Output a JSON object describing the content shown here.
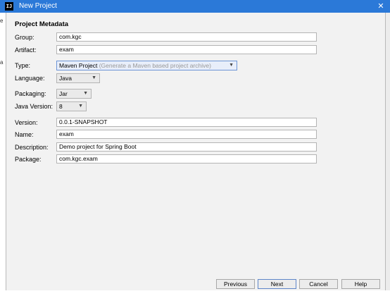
{
  "window": {
    "title": "New Project",
    "icon_text": "IJ"
  },
  "section_title": "Project Metadata",
  "fields": {
    "group": {
      "label": "Group:",
      "value": "com.kgc"
    },
    "artifact": {
      "label": "Artifact:",
      "value": "exam"
    },
    "type": {
      "label": "Type:",
      "value": "Maven Project",
      "hint": "(Generate a Maven based project archive)"
    },
    "language": {
      "label": "Language:",
      "value": "Java"
    },
    "packaging": {
      "label": "Packaging:",
      "value": "Jar"
    },
    "java_version": {
      "label": "Java Version:",
      "value": "8"
    },
    "version": {
      "label": "Version:",
      "value": "0.0.1-SNAPSHOT"
    },
    "name": {
      "label": "Name:",
      "value": "exam"
    },
    "description": {
      "label": "Description:",
      "value": "Demo project for Spring Boot"
    },
    "package": {
      "label": "Package:",
      "value": "com.kgc.exam"
    }
  },
  "buttons": {
    "previous": "Previous",
    "next": "Next",
    "cancel": "Cancel",
    "help": "Help"
  },
  "background_chars": [
    "e",
    "a"
  ]
}
